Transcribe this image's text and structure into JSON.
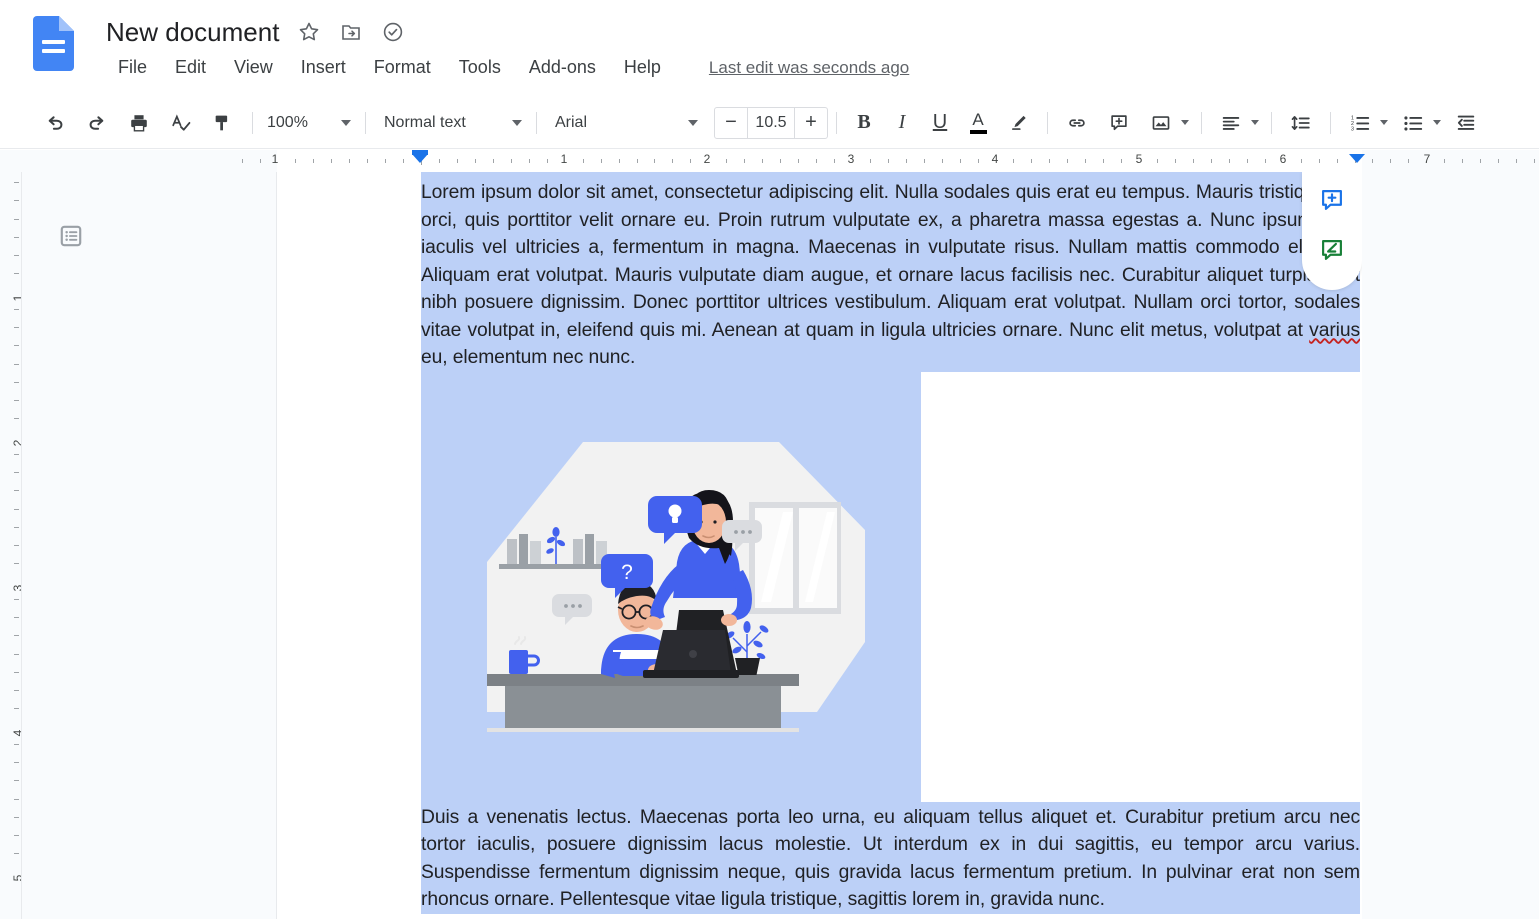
{
  "header": {
    "logo_icon": "google-docs-logo",
    "doc_title": "New document",
    "title_icons": [
      {
        "name": "star-icon",
        "glyph": "☆"
      },
      {
        "name": "move-to-folder-icon",
        "glyph": "folder-move"
      },
      {
        "name": "cloud-saved-icon",
        "glyph": "cloud-check"
      }
    ],
    "menus": [
      "File",
      "Edit",
      "View",
      "Insert",
      "Format",
      "Tools",
      "Add-ons",
      "Help"
    ],
    "last_edit": "Last edit was seconds ago"
  },
  "toolbar": {
    "undo_label": "undo-icon",
    "redo_label": "redo-icon",
    "print_label": "print-icon",
    "spellcheck_label": "spellcheck-icon",
    "paint_format_label": "paint-format-icon",
    "zoom_value": "100%",
    "paragraph_style": "Normal text",
    "font_family": "Arial",
    "font_size": "10.5",
    "decrease_font": "−",
    "increase_font": "+",
    "bold": "B",
    "italic": "I",
    "underline": "U",
    "text_color": "A",
    "highlight": "highlight-icon",
    "link": "link-icon",
    "comment": "add-comment-icon",
    "image": "insert-image-icon",
    "align": "align-icon",
    "line_spacing": "line-spacing-icon",
    "numbered_list": "numbered-list-icon",
    "bulleted_list": "bulleted-list-icon",
    "indent": "decrease-indent-icon"
  },
  "ruler": {
    "horizontal_numbers": [
      "1",
      "1",
      "2",
      "3",
      "4",
      "5",
      "6",
      "7"
    ],
    "vertical_numbers": [
      "1",
      "2",
      "3",
      "4",
      "5"
    ],
    "left_indent_position": "0.75",
    "right_indent_position": "6.25",
    "accent_color": "#1a73e8"
  },
  "sidebar": {
    "outline_icon": "document-outline-icon"
  },
  "document": {
    "paragraph1_part1": "Lorem ipsum dolor sit amet, consectetur adipiscing elit. Nulla sodales quis erat eu tempus. Mauris tristique nisi orci, quis porttitor velit ornare eu. Proin rutrum vulputate ex, a pharetra massa egestas a. Nunc ipsum felis, iaculis vel ultricies a, fermentum in magna. Maecenas in vulputate risus. Nullam mattis commodo eleifend. Aliquam erat volutpat. Mauris vulputate diam augue, et ornare lacus facilisis nec. Curabitur aliquet turpis eget nibh posuere dignissim. Donec porttitor ultrices vestibulum. Aliquam erat volutpat. Nullam orci tortor, sodales vitae volutpat in, eleifend quis mi. Aenean at quam in ligula ultricies ornare. Nunc elit metus, volutpat at ",
    "paragraph1_misspelled": "varius",
    "paragraph1_part2": " eu, elementum nec nunc.",
    "paragraph2": "Duis a venenatis lectus. Maecenas porta leo urna, eu aliquam tellus aliquet et. Curabitur pretium arcu nec tortor iaculis, posuere dignissim lacus molestie. Ut interdum ex in dui sagittis, eu tempor arcu varius. Suspendisse fermentum dignissim neque, quis gravida lacus fermentum pretium. In pulvinar erat non sem rhoncus ornare. Pellentesque vitae ligula tristique, sagittis lorem in, gravida nunc.",
    "image_alt": "office-illustration-two-coworkers-at-desk-with-laptop",
    "selection_color": "#bcd0f7"
  },
  "right_panel": {
    "add_comment_icon": "add-comment-icon",
    "suggest_edit_icon": "suggest-edit-icon",
    "add_comment_color": "#1a73e8",
    "suggest_edit_color": "#188038"
  }
}
